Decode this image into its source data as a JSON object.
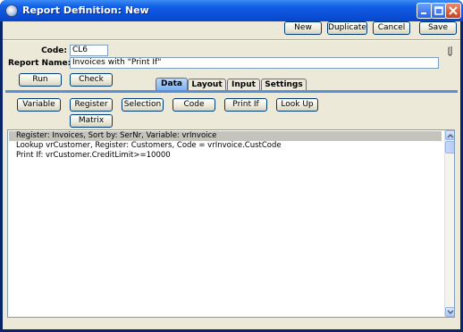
{
  "window": {
    "title": "Report Definition: New"
  },
  "toolbar": {
    "new": "New",
    "duplicate": "Duplicate",
    "cancel": "Cancel",
    "save": "Save"
  },
  "form": {
    "code_label": "Code:",
    "code_value": "CL6",
    "name_label": "Report Name:",
    "name_value": "Invoices with \"Print If\""
  },
  "actions": {
    "run": "Run",
    "check": "Check"
  },
  "tabs": [
    {
      "label": "Data",
      "active": true
    },
    {
      "label": "Layout",
      "active": false
    },
    {
      "label": "Input",
      "active": false
    },
    {
      "label": "Settings",
      "active": false
    }
  ],
  "data_buttons": {
    "variable": "Variable",
    "register": "Register",
    "selection": "Selection",
    "code": "Code",
    "print_if": "Print If",
    "look_up": "Look Up",
    "matrix": "Matrix"
  },
  "definition_lines": [
    "Register: Invoices, Sort by: SerNr, Variable: vrInvoice",
    "Lookup vrCustomer, Register: Customers, Code = vrInvoice.CustCode",
    "Print If: vrCustomer.CreditLimit>=10000"
  ],
  "colors": {
    "title_bar": "#0b4fd8",
    "active_tab": "#7fb1ec",
    "selected_row": "#c4c3bc",
    "client": "#ece9d8"
  }
}
